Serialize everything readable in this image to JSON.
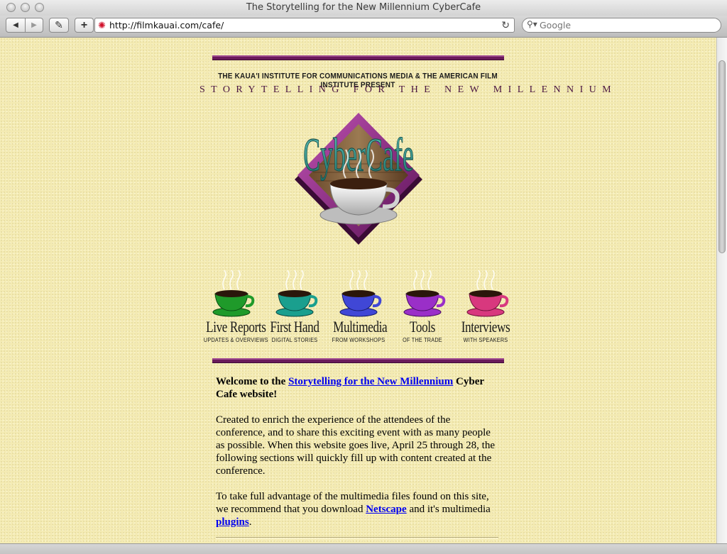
{
  "window": {
    "title": "The Storytelling for the New Millennium CyberCafe"
  },
  "toolbar": {
    "back_glyph": "◀",
    "forward_glyph": "▶",
    "edit_glyph": "✎",
    "add_glyph": "+",
    "url": "http://filmkauai.com/cafe/",
    "reload_glyph": "↻",
    "search_placeholder": "Google"
  },
  "header": {
    "presenters": "THE KAUA'I INSTITUTE FOR COMMUNICATIONS MEDIA & THE AMERICAN FILM INSTITUTE PRESENT",
    "subtitle": "STORYTELLING FOR THE NEW MILLENNIUM",
    "logo_text": "CyberCafe"
  },
  "nav": [
    {
      "title": "Live Reports",
      "subtitle": "UPDATES & OVERVIEWS",
      "cup_color": "#1f9a2a"
    },
    {
      "title": "First Hand",
      "subtitle": "DIGITAL STORIES",
      "cup_color": "#1a9f8e"
    },
    {
      "title": "Multimedia",
      "subtitle": "FROM WORKSHOPS",
      "cup_color": "#4047d6"
    },
    {
      "title": "Tools",
      "subtitle": "OF THE TRADE",
      "cup_color": "#9a2fc8"
    },
    {
      "title": "Interviews",
      "subtitle": "WITH SPEAKERS",
      "cup_color": "#d8387e"
    }
  ],
  "content": {
    "welcome_prefix": "Welcome to the ",
    "welcome_link": "Storytelling for the New Millennium",
    "welcome_suffix": " Cyber Cafe website!",
    "para1": "Created to enrich the experience of the attendees of the conference, and to share this exciting event with as many people as possible. When this website goes live, April 25 through 28, the following sections will quickly fill up with content created at the conference.",
    "para2_prefix": "To take full advantage of the multimedia files found on this site, we recommend that you download ",
    "netscape_link": "Netscape",
    "para2_middle": " and it's multimedia ",
    "plugins_link": "plugins",
    "para2_suffix": "."
  },
  "colors": {
    "page_background": "#f4ebb3",
    "rule": "#6a1a5a",
    "link": "#0000ee",
    "logo_teal": "#2f8f87",
    "logo_purple": "#7a1f75"
  }
}
